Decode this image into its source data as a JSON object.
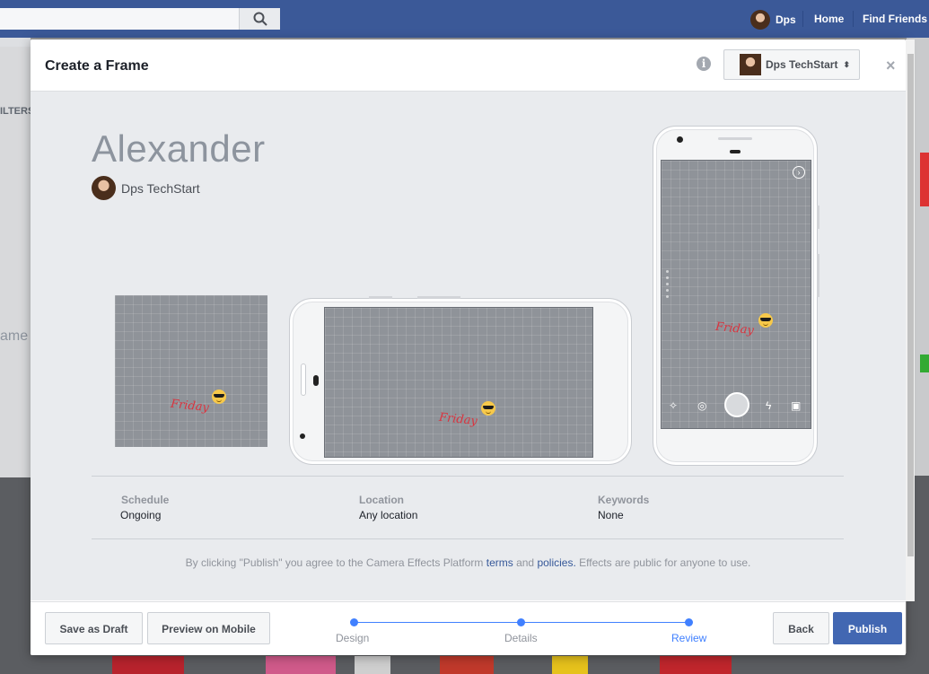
{
  "facebook": {
    "user_name": "Dps",
    "nav": [
      "Home",
      "Find Friends"
    ],
    "bg_filters_text": "ILTERS",
    "bg_frame_text": "ame"
  },
  "modal": {
    "title": "Create a Frame",
    "page_selector": {
      "label": "Dps TechStart",
      "caret": "⬍"
    },
    "close_label": "×",
    "info_label": "i"
  },
  "preview": {
    "frame_name": "Alexander",
    "owner_name": "Dps TechStart",
    "overlay_text": "Friday",
    "camera_ui_icons": [
      "magic-wand-icon",
      "camera-icon",
      "shutter-button",
      "flash-icon",
      "gallery-icon"
    ]
  },
  "details": {
    "schedule": {
      "label": "Schedule",
      "value": "Ongoing"
    },
    "location": {
      "label": "Location",
      "value": "Any location"
    },
    "keywords": {
      "label": "Keywords",
      "value": "None"
    }
  },
  "legal": {
    "before": "By clicking \"Publish\" you agree to the Camera Effects Platform ",
    "terms": "terms",
    "middle": " and ",
    "policies": "policies.",
    "after": " Effects are public for anyone to use."
  },
  "footer": {
    "save_draft": "Save as Draft",
    "preview_mobile": "Preview on Mobile",
    "steps": [
      {
        "label": "Design",
        "active": false
      },
      {
        "label": "Details",
        "active": false
      },
      {
        "label": "Review",
        "active": true
      }
    ],
    "back": "Back",
    "publish": "Publish"
  },
  "colors": {
    "facebook_blue": "#3b5998",
    "primary_button": "#4267b2",
    "step_accent": "#4080ff",
    "overlay_text": "#d9343f"
  }
}
